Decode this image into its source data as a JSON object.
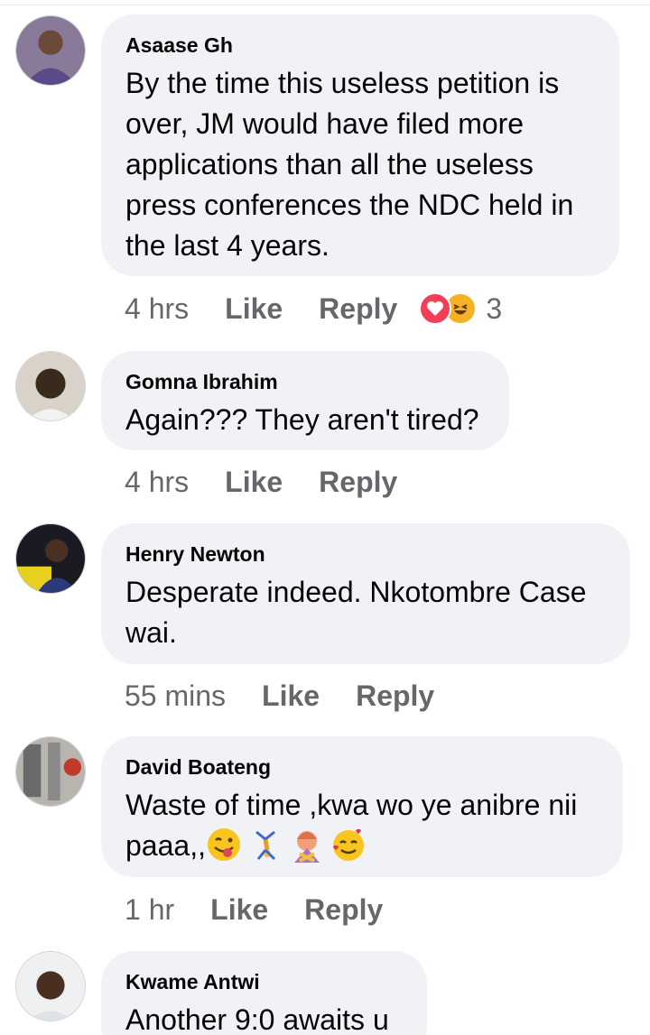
{
  "comments": [
    {
      "author": "Asaase Gh",
      "text": "By the time this useless petition is over, JM would have filed more applications than all the useless press conferences the NDC held in the last 4 years.",
      "time": "4 hrs",
      "like": "Like",
      "reply": "Reply",
      "reaction_count": "3",
      "reactions": [
        "love",
        "haha"
      ]
    },
    {
      "author": "Gomna Ibrahim",
      "text": "Again??? They aren't tired?",
      "time": "4 hrs",
      "like": "Like",
      "reply": "Reply"
    },
    {
      "author": "Henry Newton",
      "text": "Desperate indeed. Nkotombre Case wai.",
      "time": "55 mins",
      "like": "Like",
      "reply": "Reply"
    },
    {
      "author": "David Boateng",
      "text_line1": "Waste of time ,kwa wo ye anibre nii",
      "text_line2": "paaa,,",
      "emojis": [
        "winking-tongue-emoji",
        "cartwheel-emoji",
        "no-gesture-emoji",
        "smiling-hearts-emoji"
      ],
      "time": "1 hr",
      "like": "Like",
      "reply": "Reply"
    },
    {
      "author": "Kwame Antwi",
      "text": "Another 9:0 awaits u"
    }
  ],
  "colors": {
    "bubble": "#f0f2f5",
    "meta_text": "#65676b",
    "love": "#f33e58",
    "haha": "#f7b125"
  }
}
